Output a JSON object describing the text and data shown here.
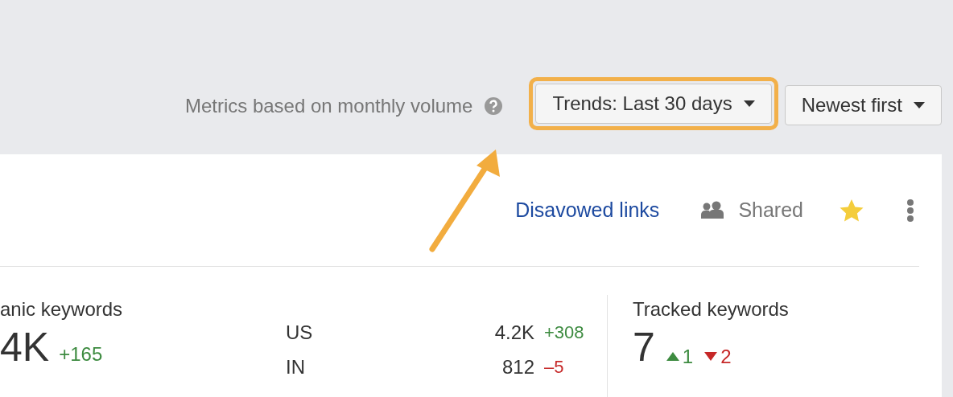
{
  "toolbar": {
    "note": "Metrics based on monthly volume",
    "buttons": [
      {
        "label": "Trends: Last 30 days",
        "highlighted": true
      },
      {
        "label": "Newest first",
        "highlighted": false
      }
    ]
  },
  "card_actions": {
    "link": "Disavowed links",
    "shared": "Shared",
    "starred": true
  },
  "organic": {
    "label": "anic keywords",
    "value": "4K",
    "change": {
      "text": "+165",
      "kind": "up"
    },
    "countries": [
      {
        "code": "US",
        "value": "4.2K",
        "change": {
          "text": "+308",
          "kind": "up"
        }
      },
      {
        "code": "IN",
        "value": "812",
        "change": {
          "text": "–5",
          "kind": "down"
        }
      }
    ]
  },
  "tracked": {
    "label": "Tracked keywords",
    "value": "7",
    "changes": [
      {
        "text": "1",
        "kind": "up"
      },
      {
        "text": "2",
        "kind": "down"
      }
    ]
  }
}
